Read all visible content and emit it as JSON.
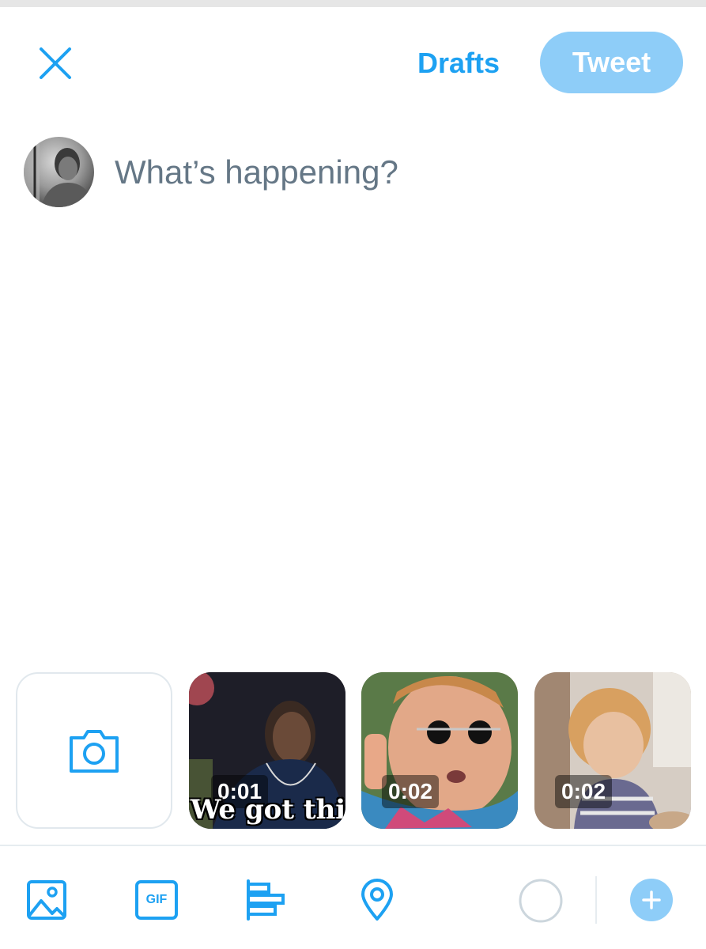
{
  "header": {
    "close_icon": "close-icon",
    "drafts_label": "Drafts",
    "tweet_label": "Tweet"
  },
  "composer": {
    "placeholder": "What’s happening?",
    "value": ""
  },
  "media_strip": {
    "camera_icon": "camera-icon",
    "gifs": [
      {
        "duration": "0:01",
        "caption": "We got this"
      },
      {
        "duration": "0:02"
      },
      {
        "duration": "0:02"
      }
    ]
  },
  "toolbar": {
    "icons": [
      "image-icon",
      "gif-icon",
      "poll-icon",
      "location-icon"
    ],
    "gif_text": "GIF",
    "add_icon": "plus-icon"
  },
  "colors": {
    "accent": "#1da1f2",
    "tweet_button_disabled": "#8ecdf8",
    "placeholder": "#657786",
    "divider": "#e6ecf0"
  }
}
